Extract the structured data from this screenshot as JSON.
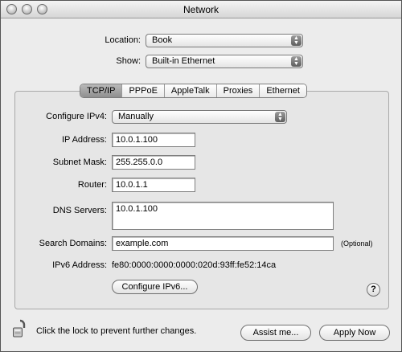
{
  "window": {
    "title": "Network"
  },
  "location": {
    "label": "Location:",
    "value": "Book"
  },
  "show": {
    "label": "Show:",
    "value": "Built-in Ethernet"
  },
  "tabs": [
    {
      "label": "TCP/IP",
      "active": true
    },
    {
      "label": "PPPoE",
      "active": false
    },
    {
      "label": "AppleTalk",
      "active": false
    },
    {
      "label": "Proxies",
      "active": false
    },
    {
      "label": "Ethernet",
      "active": false
    }
  ],
  "tcpip": {
    "configure_label": "Configure IPv4:",
    "configure_value": "Manually",
    "ip_label": "IP Address:",
    "ip_value": "10.0.1.100",
    "subnet_label": "Subnet Mask:",
    "subnet_value": "255.255.0.0",
    "router_label": "Router:",
    "router_value": "10.0.1.1",
    "dns_label": "DNS Servers:",
    "dns_value": "10.0.1.100",
    "search_label": "Search Domains:",
    "search_value": "example.com",
    "optional_text": "(Optional)",
    "ipv6_label": "IPv6 Address:",
    "ipv6_value": "fe80:0000:0000:0000:020d:93ff:fe52:14ca",
    "configure_ipv6_button": "Configure IPv6...",
    "help_button": "?"
  },
  "footer": {
    "lock_text": "Click the lock to prevent further changes.",
    "assist_button": "Assist me...",
    "apply_button": "Apply Now"
  }
}
